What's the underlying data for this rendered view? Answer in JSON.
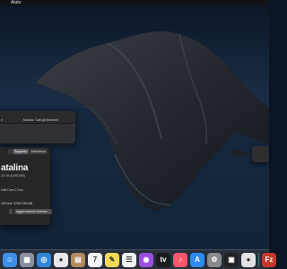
{
  "menubar": {
    "items": [
      "",
      "",
      "Aiuto"
    ]
  },
  "finder": {
    "left_label": "e",
    "show_all_label": "Mostra: Tutti gli elementi"
  },
  "about": {
    "tabs": [
      "",
      "Supporto",
      "Assistenza"
    ],
    "os_name": "atalina",
    "os_version": "10.15.4(19E266)",
    "specs": [
      "",
      "Intel Core 2 Duo",
      "",
      "",
      "GeForce 320M 256 MB"
    ],
    "buttons": [
      "",
      "Aggiornamento Software..."
    ]
  },
  "dock": {
    "icons": [
      {
        "name": "finder-icon",
        "glyph": "☺",
        "color": "#3b8fe6"
      },
      {
        "name": "launchpad-icon",
        "glyph": "▦",
        "color": "#8a8fa0"
      },
      {
        "name": "safari-icon",
        "glyph": "◎",
        "color": "#2f86d8"
      },
      {
        "name": "chrome-icon",
        "glyph": "●",
        "color": "#e9e9e9"
      },
      {
        "name": "contacts-icon",
        "glyph": "▤",
        "color": "#b38a5e"
      },
      {
        "name": "calendar-icon",
        "glyph": "7",
        "color": "#f4f4f4"
      },
      {
        "name": "notes-icon",
        "glyph": "✎",
        "color": "#f4d85a"
      },
      {
        "name": "reminders-icon",
        "glyph": "☰",
        "color": "#f2f2f2"
      },
      {
        "name": "podcasts-icon",
        "glyph": "◉",
        "color": "#9b4fe0"
      },
      {
        "name": "apple-tv-icon",
        "glyph": "tv",
        "color": "#1b1b1b"
      },
      {
        "name": "music-icon",
        "glyph": "♪",
        "color": "#f5576c"
      },
      {
        "name": "app-store-icon",
        "glyph": "A",
        "color": "#2d8cf0"
      },
      {
        "name": "system-preferences-icon",
        "glyph": "⚙",
        "color": "#8a8a8a"
      },
      {
        "name": "activity-monitor-icon",
        "glyph": "▣",
        "color": "#222"
      },
      {
        "name": "chrome-dev-icon",
        "glyph": "●",
        "color": "#e3e3e3"
      },
      {
        "name": "filezilla-icon",
        "glyph": "Fz",
        "color": "#c0392b"
      }
    ]
  },
  "colors": {
    "sky": "#0d1b2e",
    "sea": "#13253b",
    "island": "#2a2d33"
  }
}
